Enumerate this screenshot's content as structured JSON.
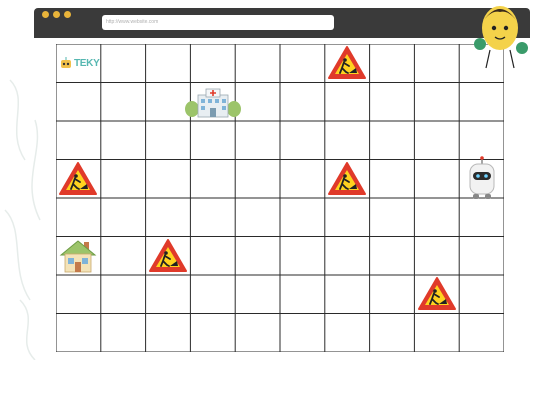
{
  "browser": {
    "address_bar": "http://www.website.com",
    "dots": [
      "#e9b43a",
      "#e9b43a",
      "#e9b43a"
    ]
  },
  "game": {
    "logo": "TEKY",
    "grid": {
      "columns": 10,
      "rows": 8
    },
    "pieces": [
      {
        "type": "roadwork-sign",
        "col": 6,
        "row": 0
      },
      {
        "type": "hospital",
        "col": 3,
        "row": 1
      },
      {
        "type": "roadwork-sign",
        "col": 0,
        "row": 3
      },
      {
        "type": "roadwork-sign",
        "col": 6,
        "row": 3
      },
      {
        "type": "robot",
        "col": 9,
        "row": 3
      },
      {
        "type": "house",
        "col": 0,
        "row": 5
      },
      {
        "type": "roadwork-sign",
        "col": 2,
        "row": 5
      },
      {
        "type": "roadwork-sign",
        "col": 8,
        "row": 6
      }
    ]
  },
  "colors": {
    "sign_border": "#e03a2a",
    "sign_fill": "#ffd21f",
    "grid_line": "#2a2a2a",
    "logo": "#56b7b1"
  }
}
